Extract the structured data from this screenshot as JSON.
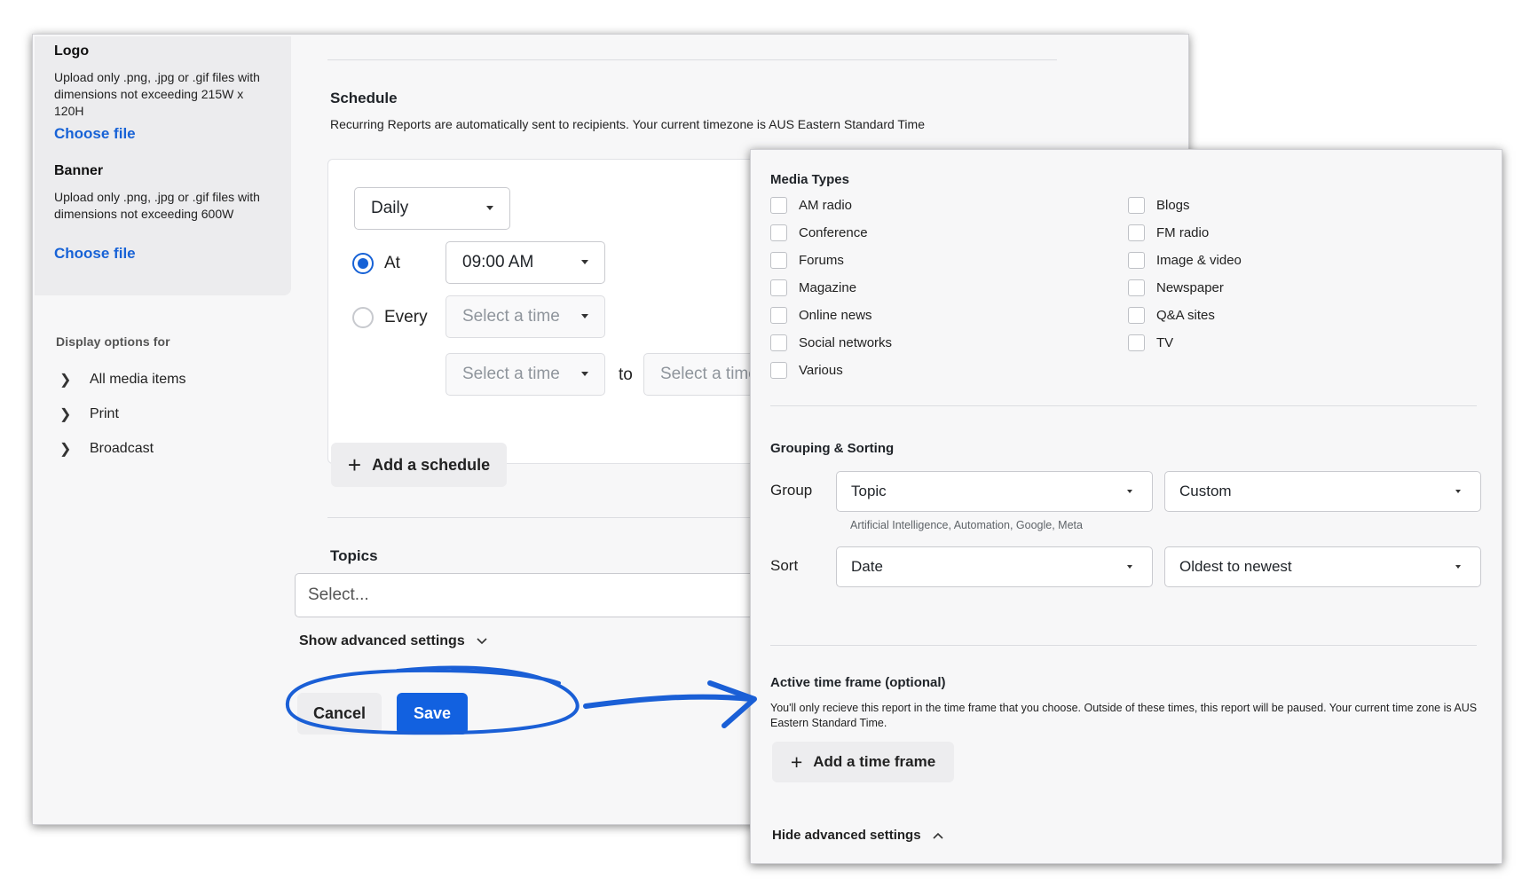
{
  "main": {
    "sidebar": {
      "logo_heading": "Logo",
      "logo_desc": "Upload only .png, .jpg or .gif files with dimensions not exceeding 215W x 120H",
      "logo_choose": "Choose file",
      "banner_heading": "Banner",
      "banner_desc": "Upload only .png, .jpg or .gif files with dimensions not exceeding 600W",
      "banner_choose": "Choose file",
      "display_options_label": "Display options for",
      "display_items": [
        "All media items",
        "Print",
        "Broadcast"
      ]
    },
    "schedule": {
      "title": "Schedule",
      "description": "Recurring Reports are automatically sent to recipients. Your current timezone is AUS Eastern Standard Time",
      "frequency": "Daily",
      "at_label": "At",
      "at_time": "09:00 AM",
      "every_label": "Every",
      "every_placeholder": "Select a time",
      "from_placeholder": "Select a time",
      "to_label": "to",
      "to_placeholder": "Select a time",
      "add_schedule": "Add a schedule"
    },
    "topics": {
      "title": "Topics",
      "placeholder": "Select..."
    },
    "show_advanced": "Show advanced settings",
    "cancel": "Cancel",
    "save": "Save"
  },
  "advanced": {
    "media_types_title": "Media Types",
    "media_col1": [
      "AM radio",
      "Conference",
      "Forums",
      "Magazine",
      "Online news",
      "Social networks",
      "Various"
    ],
    "media_col2": [
      "Blogs",
      "FM radio",
      "Image & video",
      "Newspaper",
      "Q&A sites",
      "TV"
    ],
    "grouping_title": "Grouping & Sorting",
    "group_label": "Group",
    "group_value": "Topic",
    "group_custom": "Custom",
    "group_hint": "Artificial Intelligence, Automation, Google, Meta",
    "sort_label": "Sort",
    "sort_value": "Date",
    "sort_order": "Oldest to newest",
    "timeframe_title": "Active time frame (optional)",
    "timeframe_desc": "You'll only recieve this report in the time frame that you choose. Outside of these times, this report will be paused. Your current time zone is AUS Eastern Standard Time.",
    "add_timeframe": "Add a time frame",
    "hide_advanced": "Hide advanced settings"
  },
  "colors": {
    "accent": "#1261e0",
    "link": "#1762d6",
    "annotation": "#1a5fd6"
  }
}
